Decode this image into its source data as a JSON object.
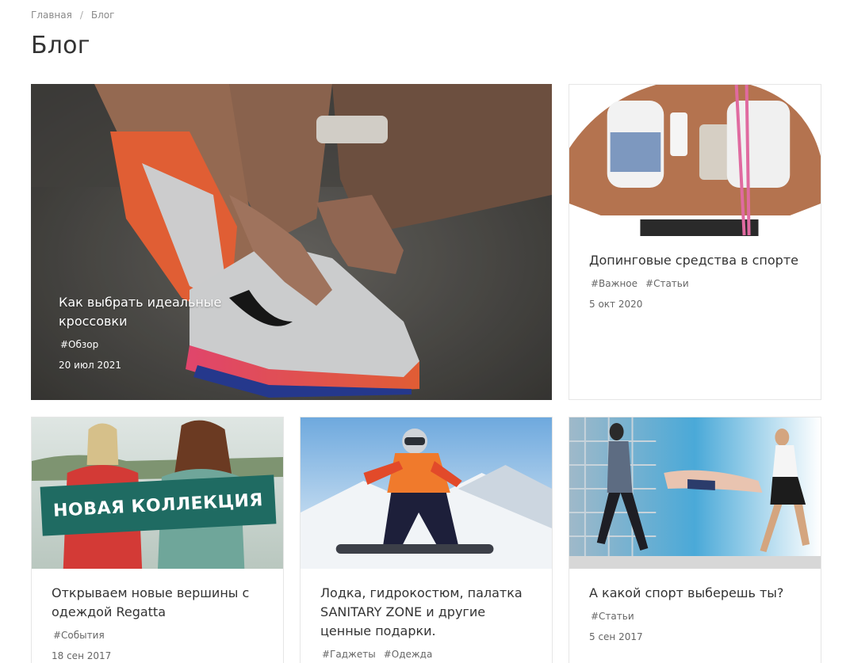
{
  "breadcrumb": {
    "home": "Главная",
    "separator": "/",
    "current": "Блог"
  },
  "page": {
    "title": "Блог"
  },
  "posts": [
    {
      "title": "Как выбрать идеальные кроссовки",
      "tags": [
        "#Обзор"
      ],
      "date": "20 июл 2021"
    },
    {
      "title": "Допинговые средства в спорте",
      "tags": [
        "#Важное",
        "#Статьи"
      ],
      "date": "5 окт 2020"
    },
    {
      "title": "Открываем новые вершины с одеждой Regatta",
      "tags": [
        "#События"
      ],
      "date": "18 сен 2017",
      "image_text": "НОВАЯ КОЛЛЕКЦИЯ"
    },
    {
      "title": "Лодка, гидрокостюм, палатка SANITARY ZONE и другие ценные подарки.",
      "tags": [
        "#Гаджеты",
        "#Одежда"
      ],
      "date": ""
    },
    {
      "title": "А какой спорт выберешь ты?",
      "tags": [
        "#Статьи"
      ],
      "date": "5 сен 2017"
    }
  ],
  "colors": {
    "banner_green": "#1f6b62",
    "text": "#333333",
    "muted": "#666666",
    "border": "#e6e6e6"
  }
}
